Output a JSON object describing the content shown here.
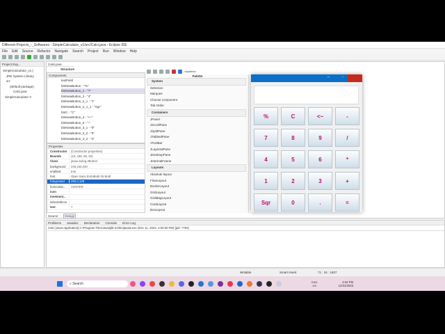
{
  "window": {
    "title": "Different-Projects_-_Softwares - SimpleCalculator_v1/src/Calci.java - Eclipse IDE"
  },
  "menu": [
    "File",
    "Edit",
    "Source",
    "Refactor",
    "Navigate",
    "Search",
    "Project",
    "Run",
    "Window",
    "Help"
  ],
  "project_explorer": {
    "tab": "Project Exp...",
    "items": [
      "SimpleCalculator_v1 [",
      "JRE System Library",
      "src",
      "(default package)",
      "Calci.java",
      "SimpleCalculator V"
    ]
  },
  "editor": {
    "tab": "Calci.java",
    "structure": "Structure",
    "components_title": "Components",
    "components": [
      "textField",
      "btnNewButton - \"%\"",
      "btnNewButton_1 - \"7\"",
      "btnNewButton_2 - \"4\"",
      "btnNewButton_2_1 - \"1\"",
      "btnNewButton_2_1_1 - \"Sqr\"",
      "btnC - \"C\"",
      "btnNewButton_4 - \"<~\"",
      "btnNewButton_5 - \"-\"",
      "btnNewButton_3_1 - \"8\"",
      "btnNewButton_3_2 - \"5\"",
      "btnNewButton_3_2 - \"2\""
    ]
  },
  "properties": {
    "title": "Properties",
    "rows": [
      {
        "k": "Constructor",
        "v": "(Constructor properties)"
      },
      {
        "k": "Bounds",
        "v": "(10, 158, 85, 62)"
      },
      {
        "k": "Class",
        "v": "javax.swing.JButton"
      },
      {
        "k": "background",
        "v": "240,240,240"
      },
      {
        "k": "enabled",
        "v": "true"
      },
      {
        "k": "font",
        "v": "Open Sans ExtraBold 25 Bold"
      },
      {
        "k": "foreground",
        "v": "255,0,128"
      },
      {
        "k": "horizontal...",
        "v": "CENTER"
      },
      {
        "k": "icon",
        "v": ""
      },
      {
        "k": "mnemoni...",
        "v": ""
      },
      {
        "k": "selectedIcon",
        "v": ""
      },
      {
        "k": "text",
        "v": "7"
      }
    ]
  },
  "bottom_tabs": {
    "source": "Source",
    "design": "Design"
  },
  "palette": {
    "title": "Palette",
    "toolbar_combo": "<system>",
    "groups": [
      {
        "name": "System",
        "items": [
          "Selection",
          "Marquee",
          "Choose component",
          "Tab Order"
        ]
      },
      {
        "name": "Containers",
        "items": [
          "JPanel",
          "JScrollPane",
          "JSplitPane",
          "JTabbedPane",
          "JToolBar",
          "JLayeredPane",
          "JDesktopPane",
          "JInternalFrame"
        ]
      },
      {
        "name": "Layouts",
        "items": [
          "Absolute layout",
          "FlowLayout",
          "BorderLayout",
          "GridLayout",
          "GridBagLayout",
          "CardLayout",
          "BoxLayout"
        ]
      }
    ]
  },
  "calculator": {
    "buttons": [
      "%",
      "C",
      "<~",
      "-",
      "7",
      "8",
      "9",
      "/",
      "4",
      "5",
      "6",
      "*",
      "1",
      "2",
      "3",
      "+",
      "Sqr",
      "0",
      ".",
      "="
    ],
    "display": "",
    "foreground": "#c00c6e"
  },
  "console": {
    "tabs": [
      "Problems",
      "Javadoc",
      "Declaration",
      "Console",
      "Error Log"
    ],
    "launch": "Calci [Java Application] C:\\Program Files\\Java\\jdk-21\\bin\\javaw.exe (Dec 11, 2023, 4:52:50 PM) [pid: 7764]"
  },
  "status": {
    "writable": "Writable",
    "insert": "Smart Insert",
    "position": "71 : 34 : 1807"
  },
  "taskbar": {
    "search": "Search",
    "lang": "ENG",
    "region": "US",
    "time": "4:53 PM",
    "date": "12/31/2023"
  }
}
